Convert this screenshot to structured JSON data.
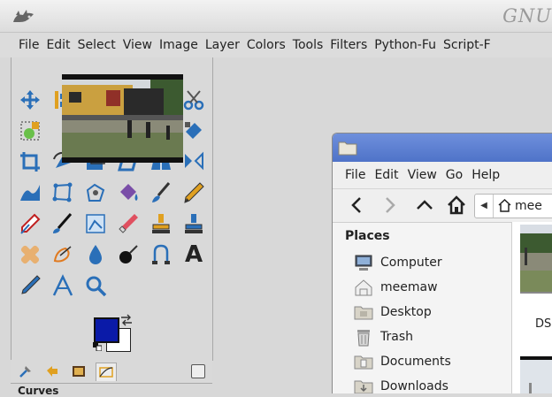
{
  "gimp": {
    "title_fragment": "GNU",
    "menu": [
      "File",
      "Edit",
      "Select",
      "View",
      "Image",
      "Layer",
      "Colors",
      "Tools",
      "Filters",
      "Python-Fu",
      "Script-F"
    ],
    "colors": {
      "foreground": "#0a1aa8",
      "background": "#ffffff"
    },
    "dock_panel_label": "Curves"
  },
  "file_manager": {
    "menu": [
      "File",
      "Edit",
      "View",
      "Go",
      "Help"
    ],
    "path_label": "mee",
    "places_heading": "Places",
    "places": [
      {
        "label": "Computer",
        "icon": "computer-icon"
      },
      {
        "label": "meemaw",
        "icon": "home-folder-icon"
      },
      {
        "label": "Desktop",
        "icon": "desktop-folder-icon"
      },
      {
        "label": "Trash",
        "icon": "trash-icon"
      },
      {
        "label": "Documents",
        "icon": "documents-folder-icon"
      },
      {
        "label": "Downloads",
        "icon": "downloads-folder-icon"
      }
    ],
    "file_label": "DS"
  }
}
